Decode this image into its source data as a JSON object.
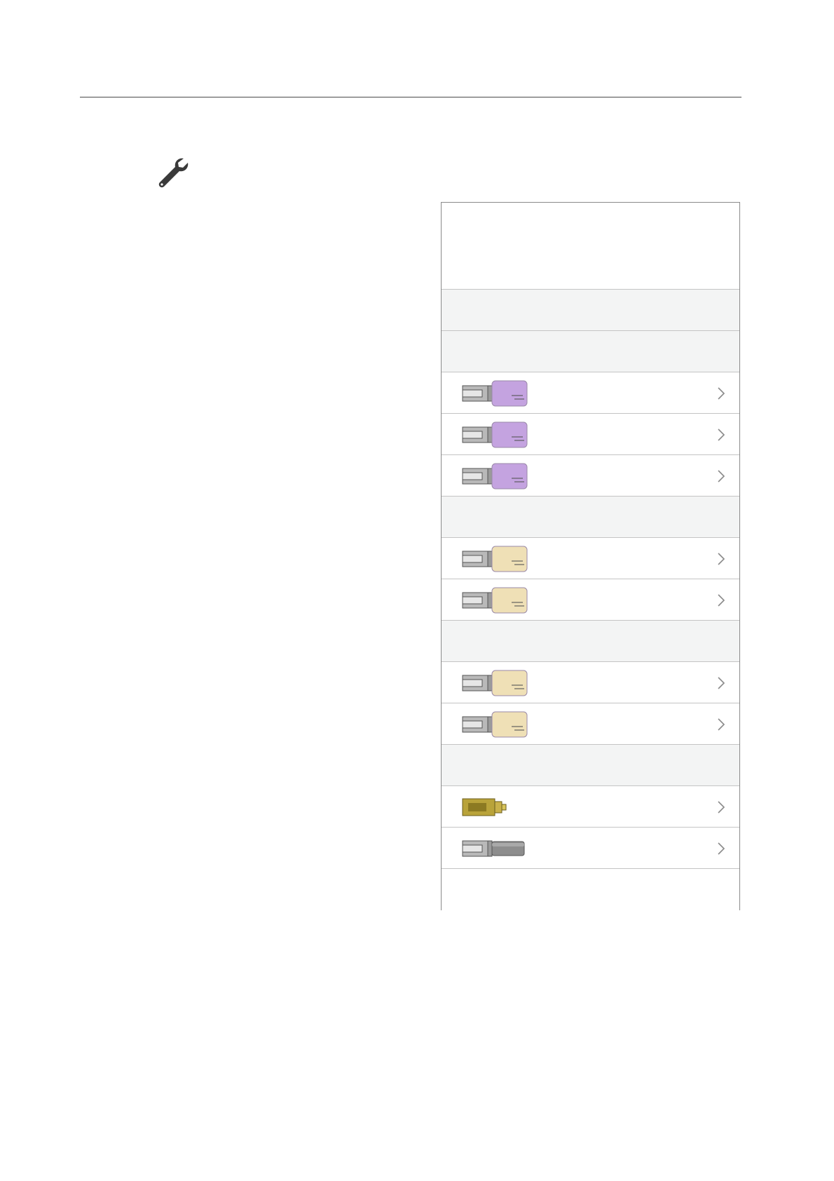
{
  "page": {
    "accent": "#4a4a4a"
  },
  "icons": {
    "header": "wrench-icon",
    "row_action": "chevron-right-icon"
  },
  "block_colors": {
    "lilac": "#c4a3e0",
    "cream": "#efe0b6",
    "brass": "#b9a33a",
    "steel": "#8d8d8d"
  },
  "panel": {
    "rows": [
      {
        "kind": "group"
      },
      {
        "kind": "group"
      },
      {
        "kind": "item",
        "block": "lilac"
      },
      {
        "kind": "item",
        "block": "lilac"
      },
      {
        "kind": "item",
        "block": "lilac"
      },
      {
        "kind": "group"
      },
      {
        "kind": "item",
        "block": "cream"
      },
      {
        "kind": "item",
        "block": "cream"
      },
      {
        "kind": "group"
      },
      {
        "kind": "item",
        "block": "cream"
      },
      {
        "kind": "item",
        "block": "cream"
      },
      {
        "kind": "group"
      },
      {
        "kind": "item",
        "block": "brass"
      },
      {
        "kind": "item",
        "block": "steel"
      },
      {
        "kind": "last"
      }
    ]
  }
}
